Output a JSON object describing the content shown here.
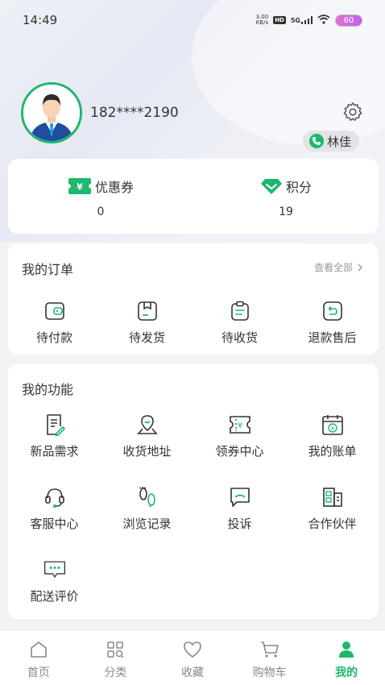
{
  "status_bar": {
    "time": "14:49",
    "speed_value": "3.00",
    "speed_unit": "KB/s",
    "hd": "HD",
    "network": "5G",
    "battery": "60"
  },
  "profile": {
    "phone": "182****2190",
    "contact_name": "林佳"
  },
  "points": {
    "coupon_label": "优惠券",
    "coupon_value": "0",
    "score_label": "积分",
    "score_value": "19"
  },
  "orders": {
    "title": "我的订单",
    "view_all": "查看全部",
    "items": [
      {
        "label": "待付款",
        "icon": "wallet-icon"
      },
      {
        "label": "待发货",
        "icon": "box-icon"
      },
      {
        "label": "待收货",
        "icon": "clipboard-icon"
      },
      {
        "label": "退款售后",
        "icon": "refund-icon"
      }
    ]
  },
  "features": {
    "title": "我的功能",
    "items": [
      {
        "label": "新品需求",
        "icon": "edit-document-icon"
      },
      {
        "label": "收货地址",
        "icon": "location-icon"
      },
      {
        "label": "领券中心",
        "icon": "coupon-icon"
      },
      {
        "label": "我的账单",
        "icon": "bill-icon"
      },
      {
        "label": "客服中心",
        "icon": "headset-icon"
      },
      {
        "label": "浏览记录",
        "icon": "footprint-icon"
      },
      {
        "label": "投诉",
        "icon": "complaint-icon"
      },
      {
        "label": "合作伙伴",
        "icon": "building-icon"
      },
      {
        "label": "配送评价",
        "icon": "chat-bubble-icon"
      }
    ]
  },
  "tabs": [
    {
      "label": "首页",
      "icon": "home-icon"
    },
    {
      "label": "分类",
      "icon": "category-icon"
    },
    {
      "label": "收藏",
      "icon": "heart-icon"
    },
    {
      "label": "购物车",
      "icon": "cart-icon"
    },
    {
      "label": "我的",
      "icon": "user-icon",
      "active": true
    }
  ],
  "colors": {
    "accent": "#1db86c",
    "text": "#333333",
    "muted": "#999999"
  }
}
